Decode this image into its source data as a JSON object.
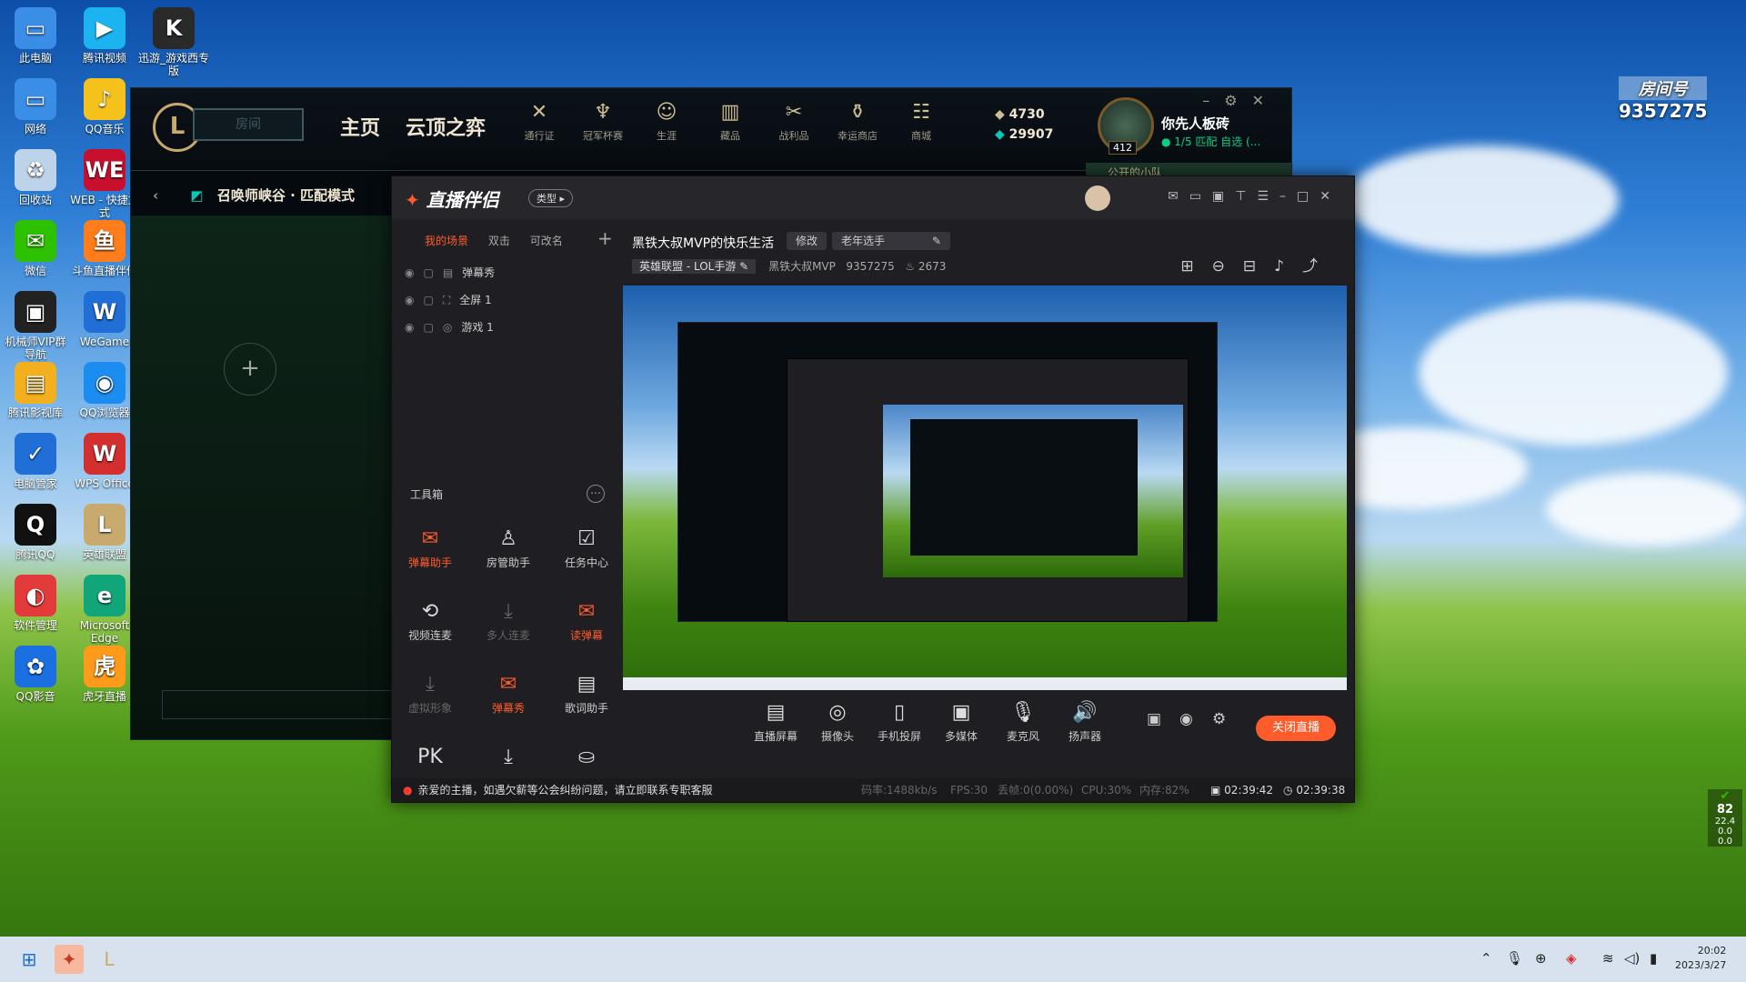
{
  "desktop": {
    "icons": [
      {
        "label": "此电脑",
        "glyph": "▭",
        "color": "#3a8ee6"
      },
      {
        "label": "腾讯视频",
        "glyph": "▶",
        "color": "#1bb3f0"
      },
      {
        "label": "迅游_游戏西专版",
        "glyph": "K",
        "color": "#2a2a2a"
      },
      {
        "label": "网络",
        "glyph": "▭",
        "color": "#3a8ee6"
      },
      {
        "label": "QQ音乐",
        "glyph": "♪",
        "color": "#f4c21b"
      },
      {
        "label": "回收站",
        "glyph": "♻",
        "color": "#bcd3ea"
      },
      {
        "label": "WEB - 快捷方式",
        "glyph": "WE",
        "color": "#c8102e"
      },
      {
        "label": "微信",
        "glyph": "✉",
        "color": "#2dc100"
      },
      {
        "label": "斗鱼直播伴侣",
        "glyph": "鱼",
        "color": "#ff7d1a"
      },
      {
        "label": "机械师VIP群导航",
        "glyph": "▣",
        "color": "#222"
      },
      {
        "label": "WeGame",
        "glyph": "W",
        "color": "#1f6fd6"
      },
      {
        "label": "腾讯影视库",
        "glyph": "▤",
        "color": "#f2b01e"
      },
      {
        "label": "QQ浏览器",
        "glyph": "◉",
        "color": "#1b8cf0"
      },
      {
        "label": "电脑管家",
        "glyph": "✓",
        "color": "#1f6fd6"
      },
      {
        "label": "WPS Office",
        "glyph": "W",
        "color": "#d42f2f"
      },
      {
        "label": "腾讯QQ",
        "glyph": "Q",
        "color": "#111"
      },
      {
        "label": "英雄联盟",
        "glyph": "L",
        "color": "#c8aa6e"
      },
      {
        "label": "软件管理",
        "glyph": "◐",
        "color": "#e33b3b"
      },
      {
        "label": "Microsoft Edge",
        "glyph": "e",
        "color": "#11a57a"
      },
      {
        "label": "QQ影音",
        "glyph": "✿",
        "color": "#1b6fe0"
      },
      {
        "label": "虎牙直播",
        "glyph": "虎",
        "color": "#ff9a1a"
      }
    ]
  },
  "lol_client": {
    "play_label": "房间",
    "tab_home": "主页",
    "tab_tft": "云顶之弈",
    "nav": [
      {
        "label": "通行证",
        "glyph": "✕"
      },
      {
        "label": "冠军杯赛",
        "glyph": "♆"
      },
      {
        "label": "生涯",
        "glyph": "☺"
      },
      {
        "label": "藏品",
        "glyph": "▥"
      },
      {
        "label": "战利品",
        "glyph": "✂"
      },
      {
        "label": "幸运商店",
        "glyph": "⚱"
      },
      {
        "label": "商城",
        "glyph": "☷"
      }
    ],
    "currency_be": "4730",
    "currency_rp": "29907",
    "level": "412",
    "summoner_name": "你先人板砖",
    "status": "1/5 匹配 自选 (...",
    "party_label": "公开的小队",
    "mode_title": "召唤师峡谷 · 匹配模式"
  },
  "live_companion": {
    "app_name": "直播伴侣",
    "type_btn": "类型 ▸",
    "scene_tabs": [
      "我的场景",
      "双击",
      "可改名"
    ],
    "scenes": [
      "弹幕秀",
      "全屏 1",
      "游戏 1"
    ],
    "toolbox_title": "工具箱",
    "tools": [
      {
        "label": "弹幕助手",
        "glyph": "✉",
        "state": "red"
      },
      {
        "label": "房管助手",
        "glyph": "♙",
        "state": "normal"
      },
      {
        "label": "任务中心",
        "glyph": "☑",
        "state": "normal"
      },
      {
        "label": "视频连麦",
        "glyph": "⟲",
        "state": "normal"
      },
      {
        "label": "多人连麦",
        "glyph": "⤓",
        "state": "dim"
      },
      {
        "label": "读弹幕",
        "glyph": "✉",
        "state": "red"
      },
      {
        "label": "虚拟形象",
        "glyph": "⤓",
        "state": "dim"
      },
      {
        "label": "弹幕秀",
        "glyph": "✉",
        "state": "red"
      },
      {
        "label": "歌词助手",
        "glyph": "▤",
        "state": "normal"
      },
      {
        "label": "",
        "glyph": "PK",
        "state": "normal"
      },
      {
        "label": "",
        "glyph": "⤓",
        "state": "normal"
      },
      {
        "label": "",
        "glyph": "⛀",
        "state": "normal"
      }
    ],
    "room_title": "黑铁大叔MVP的快乐生活",
    "edit_label": "修改",
    "tag_label": "老年选手",
    "game_label": "英雄联盟 - LOL手游",
    "streamer": "黑铁大叔MVP",
    "room_id": "9357275",
    "heat": "2673",
    "bottom_tools": [
      {
        "label": "直播屏幕",
        "glyph": "▤"
      },
      {
        "label": "摄像头",
        "glyph": "◎"
      },
      {
        "label": "手机投屏",
        "glyph": "▯"
      },
      {
        "label": "多媒体",
        "glyph": "▣"
      },
      {
        "label": "麦克风",
        "glyph": "🎙"
      },
      {
        "label": "扬声器",
        "glyph": "🔊"
      }
    ],
    "end_live": "关闭直播",
    "notice": "亲爱的主播，如遇欠薪等公会纠纷问题，请立即联系专职客服",
    "bitrate": "码率:1488kb/s",
    "fps": "FPS:30",
    "drop": "丢帧:0(0.00%)",
    "cpu": "CPU:30%",
    "mem": "内存:82%",
    "time_live": "02:39:42",
    "time_total": "02:39:38"
  },
  "overlay": {
    "room_label": "房间号",
    "room_number": "9357275",
    "side_value": "82",
    "side_sub1": "22.4",
    "side_sub2": "0.0",
    "side_sub3": "0.0"
  },
  "taskbar": {
    "time": "20:02",
    "date": "2023/3/27"
  }
}
